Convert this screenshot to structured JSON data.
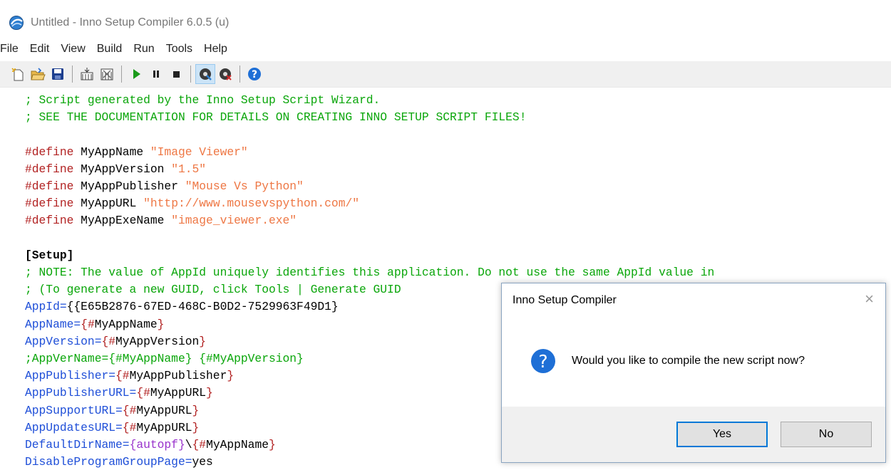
{
  "window": {
    "title": "Untitled - Inno Setup Compiler 6.0.5 (u)"
  },
  "menu": [
    "File",
    "Edit",
    "View",
    "Build",
    "Run",
    "Tools",
    "Help"
  ],
  "toolbar": {
    "buttons": [
      "new-file-icon",
      "open-folder-icon",
      "save-icon",
      "compile-icon",
      "stop-compile-icon",
      "run-icon",
      "pause-icon",
      "stop-icon",
      "target-setup-icon",
      "target-uninstall-icon",
      "help-icon"
    ],
    "colors": {
      "run": "#1a9a1a",
      "help": "#1e6fd6"
    }
  },
  "editor": {
    "lines": [
      "; Script generated by the Inno Setup Script Wizard.",
      "; SEE THE DOCUMENTATION FOR DETAILS ON CREATING INNO SETUP SCRIPT FILES!",
      "",
      "#define MyAppName \"Image Viewer\"",
      "#define MyAppVersion \"1.5\"",
      "#define MyAppPublisher \"Mouse Vs Python\"",
      "#define MyAppURL \"http://www.mousevspython.com/\"",
      "#define MyAppExeName \"image_viewer.exe\"",
      "",
      "[Setup]",
      "; NOTE: The value of AppId uniquely identifies this application. Do not use the same AppId value in",
      "; (To generate a new GUID, click Tools | Generate GUID",
      "AppId={{E65B2876-67ED-468C-B0D2-7529963F49D1}",
      "AppName={#MyAppName}",
      "AppVersion={#MyAppVersion}",
      ";AppVerName={#MyAppName} {#MyAppVersion}",
      "AppPublisher={#MyAppPublisher}",
      "AppPublisherURL={#MyAppURL}",
      "AppSupportURL={#MyAppURL}",
      "AppUpdatesURL={#MyAppURL}",
      "DefaultDirName={autopf}\\{#MyAppName}",
      "DisableProgramGroupPage=yes"
    ]
  },
  "dialog": {
    "title": "Inno Setup Compiler",
    "close": "×",
    "message": "Would you like to compile the new script now?",
    "yes_label": "Yes",
    "no_label": "No"
  }
}
